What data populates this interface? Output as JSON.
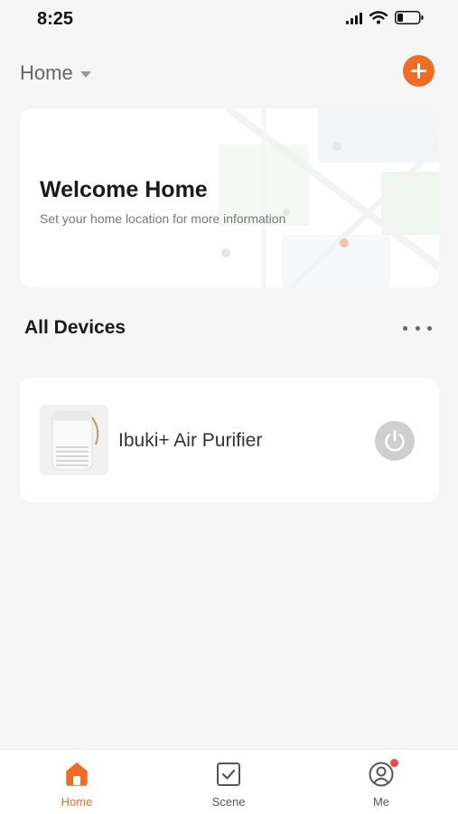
{
  "status_bar": {
    "time": "8:25",
    "icons": [
      "signal-icon",
      "wifi-icon",
      "battery-icon"
    ]
  },
  "header": {
    "home_label": "Home",
    "add_icon": "plus-icon"
  },
  "welcome": {
    "title": "Welcome Home",
    "subtitle": "Set your home location for more information"
  },
  "devices_section": {
    "title": "All Devices",
    "more_icon": "more-horizontal-icon"
  },
  "devices": [
    {
      "name": "Ibuki+ Air Purifier",
      "power_icon": "power-icon",
      "power_on": false
    }
  ],
  "tabs": [
    {
      "label": "Home",
      "icon": "home-icon",
      "active": true
    },
    {
      "label": "Scene",
      "icon": "checkbox-icon",
      "active": false
    },
    {
      "label": "Me",
      "icon": "user-icon",
      "active": false,
      "badge": true
    }
  ],
  "colors": {
    "accent": "#f26b25",
    "background": "#f6f6f6",
    "card": "#ffffff",
    "badge": "#f04a47",
    "power_off": "#cfcfcf"
  }
}
